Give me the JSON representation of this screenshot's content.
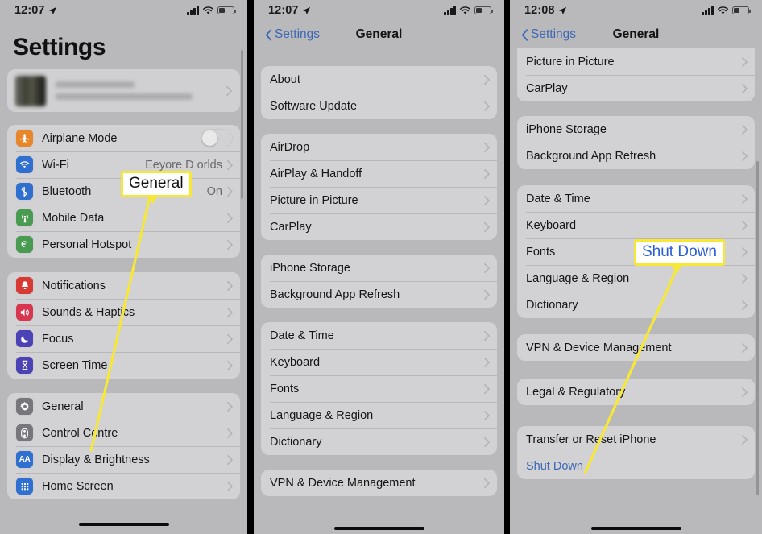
{
  "panels": [
    {
      "id": "settings-root",
      "status": {
        "time": "12:07",
        "location_icon": "location-arrow-icon",
        "battery_icon": "battery-icon",
        "wifi_icon": "wifi-icon",
        "signal_icon": "cellular-signal-icon"
      },
      "title": "Settings",
      "account": {
        "name_blurred": "",
        "subtitle_blurred": "",
        "chevron": "chevron-right-icon"
      },
      "groups": [
        {
          "rows": [
            {
              "label": "Airplane Mode",
              "icon": "airplane-icon",
              "icon_color": "#e8862a",
              "control": "toggle",
              "toggle_on": false
            },
            {
              "label": "Wi-Fi",
              "icon": "wifi-icon",
              "icon_color": "#2f6fd0",
              "value": "Eeyore D            orlds",
              "chevron": true
            },
            {
              "label": "Bluetooth",
              "icon": "bluetooth-icon",
              "icon_color": "#2f6fd0",
              "value": "On",
              "chevron": true
            },
            {
              "label": "Mobile Data",
              "icon": "mobile-data-icon",
              "icon_color": "#4a9b52",
              "chevron": true
            },
            {
              "label": "Personal Hotspot",
              "icon": "personal-hotspot-icon",
              "icon_color": "#4a9b52",
              "chevron": true
            }
          ]
        },
        {
          "rows": [
            {
              "label": "Notifications",
              "icon": "bell-icon",
              "icon_color": "#d83a33",
              "chevron": true
            },
            {
              "label": "Sounds & Haptics",
              "icon": "speaker-icon",
              "icon_color": "#d8364f",
              "chevron": true
            },
            {
              "label": "Focus",
              "icon": "moon-icon",
              "icon_color": "#4a42b5",
              "chevron": true
            },
            {
              "label": "Screen Time",
              "icon": "hourglass-icon",
              "icon_color": "#4a42b5",
              "chevron": true
            }
          ]
        },
        {
          "rows": [
            {
              "label": "General",
              "icon": "gear-icon",
              "icon_color": "#77777b",
              "chevron": true
            },
            {
              "label": "Control Centre",
              "icon": "control-centre-icon",
              "icon_color": "#77777b",
              "chevron": true
            },
            {
              "label": "Display & Brightness",
              "icon": "display-brightness-icon",
              "icon_color": "#2f6fd0",
              "chevron": true
            },
            {
              "label": "Home Screen",
              "icon": "home-screen-icon",
              "icon_color": "#2f6fd0",
              "chevron": true
            }
          ]
        }
      ]
    },
    {
      "id": "general-top",
      "status": {
        "time": "12:07"
      },
      "nav": {
        "back_label": "Settings",
        "title": "General",
        "back_icon": "chevron-left-icon"
      },
      "groups": [
        {
          "rows": [
            {
              "label": "About",
              "chevron": true
            },
            {
              "label": "Software Update",
              "chevron": true
            }
          ]
        },
        {
          "rows": [
            {
              "label": "AirDrop",
              "chevron": true
            },
            {
              "label": "AirPlay & Handoff",
              "chevron": true
            },
            {
              "label": "Picture in Picture",
              "chevron": true
            },
            {
              "label": "CarPlay",
              "chevron": true
            }
          ]
        },
        {
          "rows": [
            {
              "label": "iPhone Storage",
              "chevron": true
            },
            {
              "label": "Background App Refresh",
              "chevron": true
            }
          ]
        },
        {
          "rows": [
            {
              "label": "Date & Time",
              "chevron": true
            },
            {
              "label": "Keyboard",
              "chevron": true
            },
            {
              "label": "Fonts",
              "chevron": true
            },
            {
              "label": "Language & Region",
              "chevron": true
            },
            {
              "label": "Dictionary",
              "chevron": true
            }
          ]
        },
        {
          "rows": [
            {
              "label": "VPN & Device Management",
              "chevron": true
            }
          ]
        }
      ]
    },
    {
      "id": "general-bottom",
      "status": {
        "time": "12:08"
      },
      "nav": {
        "back_label": "Settings",
        "title": "General",
        "back_icon": "chevron-left-icon"
      },
      "groups": [
        {
          "rows": [
            {
              "label": "Picture in Picture",
              "chevron": true
            },
            {
              "label": "CarPlay",
              "chevron": true
            }
          ]
        },
        {
          "rows": [
            {
              "label": "iPhone Storage",
              "chevron": true
            },
            {
              "label": "Background App Refresh",
              "chevron": true
            }
          ]
        },
        {
          "rows": [
            {
              "label": "Date & Time",
              "chevron": true
            },
            {
              "label": "Keyboard",
              "chevron": true
            },
            {
              "label": "Fonts",
              "chevron": true
            },
            {
              "label": "Language & Region",
              "chevron": true
            },
            {
              "label": "Dictionary",
              "chevron": true
            }
          ]
        },
        {
          "rows": [
            {
              "label": "VPN & Device Management",
              "chevron": true
            }
          ]
        },
        {
          "rows": [
            {
              "label": "Legal & Regulatory",
              "chevron": true
            }
          ]
        },
        {
          "rows": [
            {
              "label": "Transfer or Reset iPhone",
              "chevron": true
            },
            {
              "label": "Shut Down",
              "link": true
            }
          ]
        }
      ]
    }
  ],
  "annotations": {
    "callout_general": "General",
    "callout_shutdown": "Shut Down",
    "highlight_color": "#f7e836",
    "link_color": "#3b68b5"
  }
}
